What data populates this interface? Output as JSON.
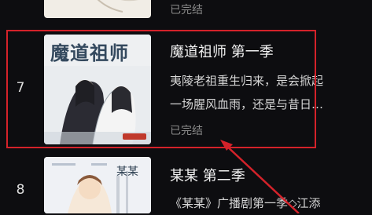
{
  "list": {
    "items": [
      {
        "rank": "",
        "title": "",
        "description_lines": [],
        "status": "已完结"
      },
      {
        "rank": "7",
        "title": "魔道祖师 第一季",
        "cover_title": "魔道祖师",
        "description_lines": [
          "夷陵老祖重生归来，是会掀起",
          "一场腥风血雨，还是与昔日…"
        ],
        "status": "已完结"
      },
      {
        "rank": "8",
        "title": "某某 第二季",
        "cover_title": "某某",
        "description_lines": [
          "《某某》广播剧第一季◇江添"
        ],
        "status": ""
      }
    ]
  },
  "annotation": {
    "highlight_color": "#d4222a"
  }
}
